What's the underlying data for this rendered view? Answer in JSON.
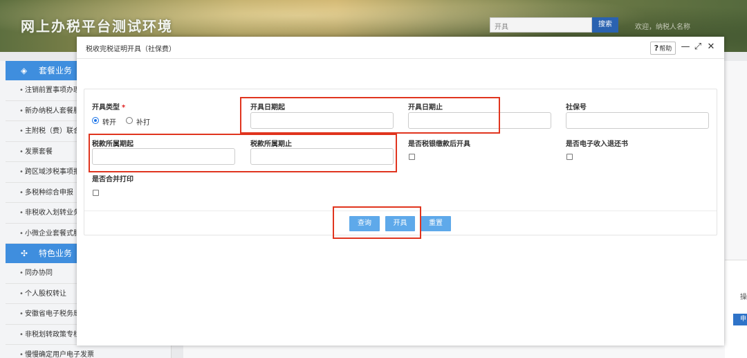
{
  "banner": {
    "site_title": "网上办税平台测试环境",
    "search_value": "开具",
    "search_button": "搜索",
    "welcome_text": "欢迎，纳税人名称"
  },
  "sidebar": {
    "groups": [
      {
        "label": "套餐业务",
        "icon": "layers-icon"
      },
      {
        "label": "特色业务",
        "icon": "grid-icon"
      }
    ],
    "items_group1": [
      "注销前置事项办理",
      "新办纳税人套餐服务",
      "主附税（费）联合申报",
      "发票套餐",
      "跨区域涉税事项报告",
      "多税种综合申报",
      "非税收入划转业务",
      "小微企业套餐式服务"
    ],
    "items_group2": [
      "同办协同",
      "个人股权转让",
      "安徽省电子税务局",
      "非税划转政策专栏",
      "慢慢确定用户电子发票"
    ]
  },
  "background": {
    "right_text": "操",
    "right_button": "申"
  },
  "modal": {
    "title": "税收完税证明开具（社保费）",
    "help_label": "帮助",
    "help_mark": "?",
    "minimize_glyph": "—",
    "maximize_glyph": "⤢",
    "close_glyph": "✕"
  },
  "form": {
    "issue_type_label": "开具类型",
    "required_mark": "*",
    "radio_transfer": "转开",
    "radio_reprint": "补打",
    "date_start_label": "开具日期起",
    "date_end_label": "开具日期止",
    "social_security_no_label": "社保号",
    "tax_period_start_label": "税款所属期起",
    "tax_period_end_label": "税款所属期止",
    "after_payment_label": "是否税银缴款后开具",
    "e_refund_label": "是否电子收入退还书",
    "merge_print_label": "是否合并打印",
    "values": {
      "date_start": "",
      "date_end": "",
      "social_security_no": "",
      "tax_period_start": "",
      "tax_period_end": ""
    }
  },
  "buttons": {
    "query": "查询",
    "issue": "开具",
    "reset": "重置"
  },
  "colors": {
    "primary_blue": "#3f8ede",
    "button_blue": "#5ea9ea",
    "highlight_red": "#e0341e",
    "required_red": "#e02020"
  }
}
